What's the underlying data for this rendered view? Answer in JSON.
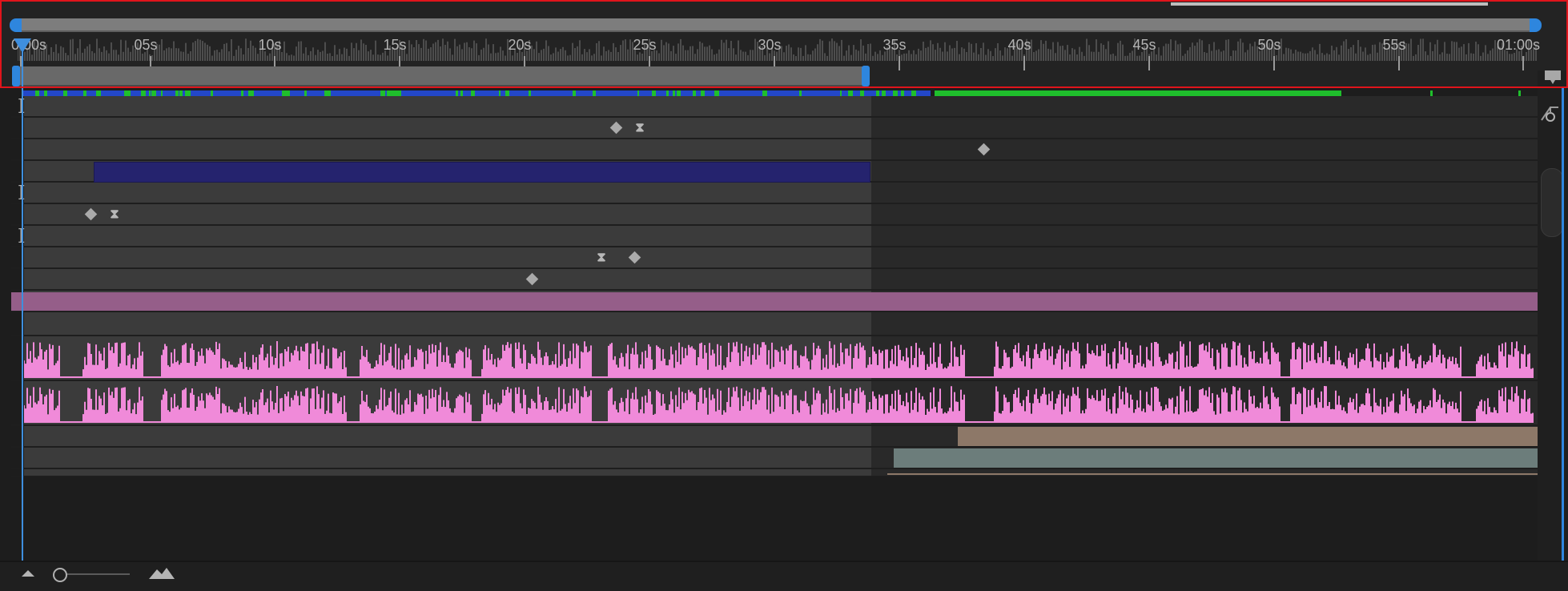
{
  "ruler": {
    "ticks": [
      "0:00s",
      "05s",
      "10s",
      "15s",
      "20s",
      "25s",
      "30s",
      "35s",
      "40s",
      "45s",
      "50s",
      "55s",
      "01:00s"
    ]
  },
  "colors": {
    "playhead": "#3f8fde",
    "solid_layer": "#25236e",
    "adjustment_layer": "#955e89",
    "audio_waveform": "#f08ad9",
    "brown_layer": "#8d7868",
    "teal_layer": "#6c7d7b"
  },
  "icons": {
    "playhead": "playhead-icon",
    "zoom_out": "mountain-small-icon",
    "zoom_in": "mountain-large-icon",
    "comment": "comment-icon",
    "graph": "graph-editor-icon"
  }
}
